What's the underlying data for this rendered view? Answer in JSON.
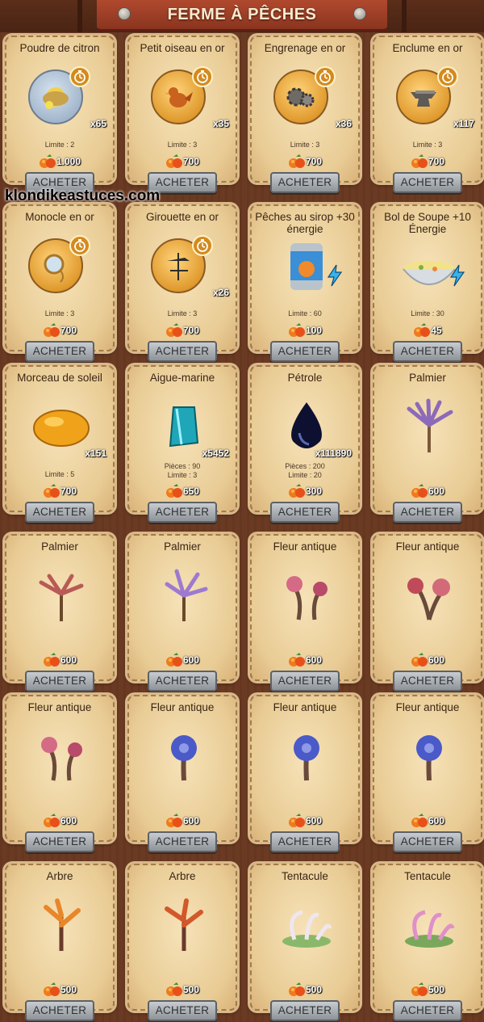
{
  "header": {
    "title": "FERME À PÊCHES"
  },
  "watermark": "klondikeastuces.com",
  "colors": {
    "background": "#6b3a22",
    "banner": "#9c3d24",
    "card": "#f1d7a6",
    "button": "#b4b8bc"
  },
  "items": [
    {
      "title": "Poudre de citron",
      "icon": "lemon-powder-icon",
      "count": "x65",
      "limit": "Limite : 2",
      "price": "1.000",
      "button": "ACHETER"
    },
    {
      "title": "Petit oiseau en or",
      "icon": "golden-bird-icon",
      "count": "x35",
      "limit": "Limite : 3",
      "price": "700",
      "button": "ACHETER"
    },
    {
      "title": "Engrenage en or",
      "icon": "golden-gear-icon",
      "count": "x36",
      "limit": "Limite : 3",
      "price": "700",
      "button": "ACHETER"
    },
    {
      "title": "Enclume en or",
      "icon": "golden-anvil-icon",
      "count": "x117",
      "limit": "Limite : 3",
      "price": "700",
      "button": "ACHETER"
    },
    {
      "title": "Monocle en or",
      "icon": "golden-monocle-icon",
      "count": "",
      "limit": "Limite : 3",
      "price": "700",
      "button": "ACHETER"
    },
    {
      "title": "Girouette en or",
      "icon": "golden-weathervane-icon",
      "count": "x26",
      "limit": "Limite : 3",
      "price": "700",
      "button": "ACHETER"
    },
    {
      "title": "Pêches au sirop +30 énergie",
      "icon": "canned-peaches-icon",
      "count": "",
      "limit": "Limite : 60",
      "price": "100",
      "button": "ACHETER"
    },
    {
      "title": "Bol de Soupe +10 Énergie",
      "icon": "soup-bowl-icon",
      "count": "",
      "limit": "Limite : 30",
      "price": "45",
      "button": "ACHETER"
    },
    {
      "title": "Morceau de soleil",
      "icon": "amber-icon",
      "count": "x151",
      "limit": "Limite : 5",
      "price": "700",
      "button": "ACHETER"
    },
    {
      "title": "Aigue-marine",
      "icon": "aquamarine-icon",
      "count": "x5452",
      "limit": "Pièces : 90",
      "limit2": "Limite : 3",
      "price": "650",
      "button": "ACHETER"
    },
    {
      "title": "Pétrole",
      "icon": "oil-drop-icon",
      "count": "x111890",
      "limit": "Pièces : 200",
      "limit2": "Limite : 20",
      "price": "300",
      "button": "ACHETER"
    },
    {
      "title": "Palmier",
      "icon": "palm-purple-icon",
      "count": "",
      "limit": "",
      "price": "600",
      "button": "ACHETER"
    },
    {
      "title": "Palmier",
      "icon": "palm-pink-icon",
      "count": "",
      "limit": "",
      "price": "600",
      "button": "ACHETER"
    },
    {
      "title": "Palmier",
      "icon": "palm-violet-icon",
      "count": "",
      "limit": "",
      "price": "600",
      "button": "ACHETER"
    },
    {
      "title": "Fleur antique",
      "icon": "ancient-flower-pink-icon",
      "count": "",
      "limit": "",
      "price": "600",
      "button": "ACHETER"
    },
    {
      "title": "Fleur antique",
      "icon": "ancient-flower-red-icon",
      "count": "",
      "limit": "",
      "price": "600",
      "button": "ACHETER"
    },
    {
      "title": "Fleur antique",
      "icon": "ancient-flower-pink-icon",
      "count": "",
      "limit": "",
      "price": "600",
      "button": "ACHETER"
    },
    {
      "title": "Fleur antique",
      "icon": "ancient-flower-blue-icon",
      "count": "",
      "limit": "",
      "price": "600",
      "button": "ACHETER"
    },
    {
      "title": "Fleur antique",
      "icon": "ancient-flower-blue-icon",
      "count": "",
      "limit": "",
      "price": "600",
      "button": "ACHETER"
    },
    {
      "title": "Fleur antique",
      "icon": "ancient-flower-blue-icon",
      "count": "",
      "limit": "",
      "price": "600",
      "button": "ACHETER"
    },
    {
      "title": "Arbre",
      "icon": "tree-orange-icon",
      "count": "",
      "limit": "",
      "price": "500",
      "button": "ACHETER"
    },
    {
      "title": "Arbre",
      "icon": "tree-red-icon",
      "count": "",
      "limit": "",
      "price": "500",
      "button": "ACHETER"
    },
    {
      "title": "Tentacule",
      "icon": "tentacle-white-icon",
      "count": "",
      "limit": "",
      "price": "500",
      "button": "ACHETER"
    },
    {
      "title": "Tentacule",
      "icon": "tentacle-pink-icon",
      "count": "",
      "limit": "",
      "price": "500",
      "button": "ACHETER"
    }
  ]
}
